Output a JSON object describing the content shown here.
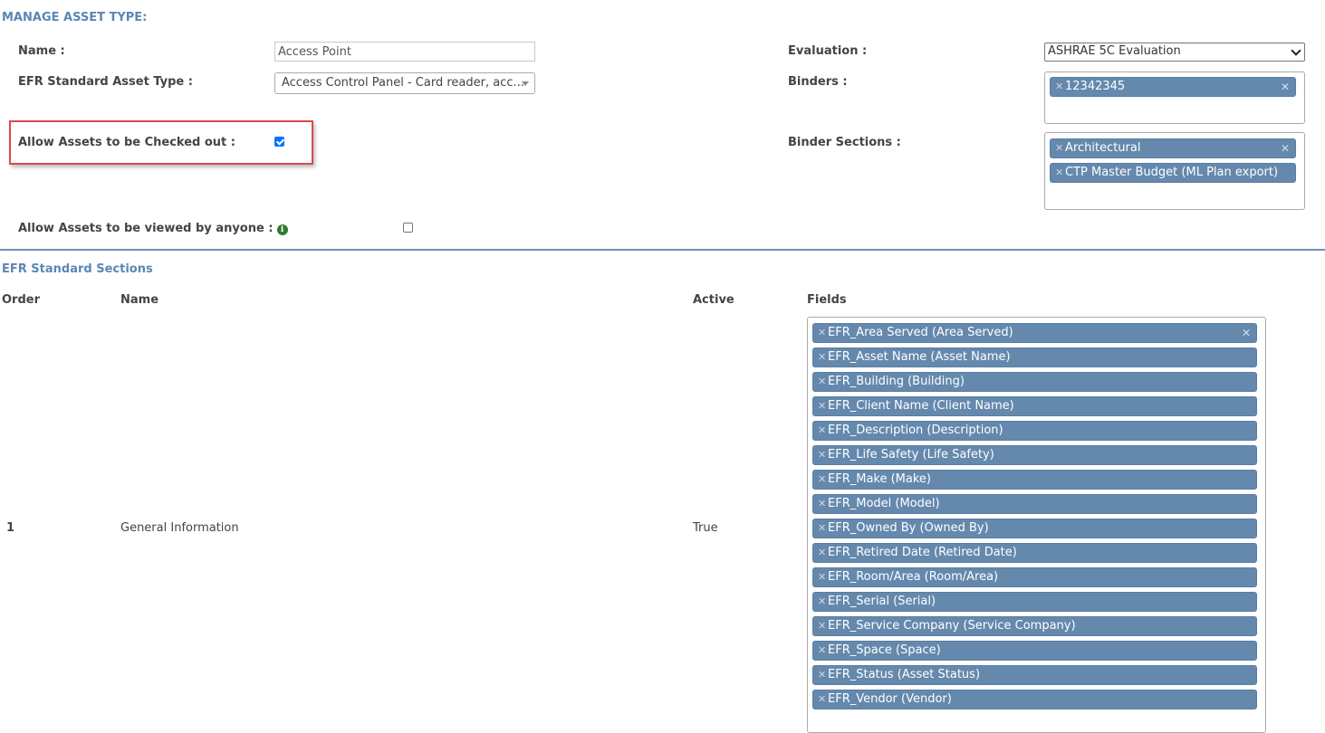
{
  "page": {
    "title": "MANAGE ASSET TYPE:"
  },
  "form": {
    "name_label": "Name :",
    "name_value": "Access Point",
    "efr_type_label": "EFR Standard Asset Type :",
    "efr_type_value": "Access Control Panel - Card reader, acc...",
    "checkout_label": "Allow Assets to be Checked out :",
    "checkout_checked": true,
    "viewed_label": "Allow Assets to be viewed by anyone :",
    "viewed_checked": false,
    "evaluation_label": "Evaluation :",
    "evaluation_value": "ASHRAE 5C Evaluation",
    "binders_label": "Binders :",
    "binders": [
      "12342345"
    ],
    "binder_sections_label": "Binder Sections :",
    "binder_sections": [
      "Architectural",
      "CTP Master Budget (ML Plan export)"
    ]
  },
  "efr_sections": {
    "title": "EFR Standard Sections",
    "columns": {
      "order": "Order",
      "name": "Name",
      "active": "Active",
      "fields": "Fields"
    },
    "rows": [
      {
        "order": "1",
        "name": "General Information",
        "active": "True",
        "fields": [
          "EFR_Area Served (Area Served)",
          "EFR_Asset Name (Asset Name)",
          "EFR_Building (Building)",
          "EFR_Client Name (Client Name)",
          "EFR_Description (Description)",
          "EFR_Life Safety (Life Safety)",
          "EFR_Make (Make)",
          "EFR_Model (Model)",
          "EFR_Owned By (Owned By)",
          "EFR_Retired Date (Retired Date)",
          "EFR_Room/Area (Room/Area)",
          "EFR_Serial (Serial)",
          "EFR_Service Company (Service Company)",
          "EFR_Space (Space)",
          "EFR_Status (Asset Status)",
          "EFR_Vendor (Vendor)"
        ]
      }
    ]
  },
  "colors": {
    "accent": "#5a87b5",
    "tag_bg": "#6589ad",
    "highlight": "#e0474b",
    "checkbox": "#0075ff",
    "info": "#2e7d32"
  },
  "icons": {
    "remove": "times-icon",
    "info": "info-circle-icon",
    "dropdown": "caret-down-icon"
  }
}
